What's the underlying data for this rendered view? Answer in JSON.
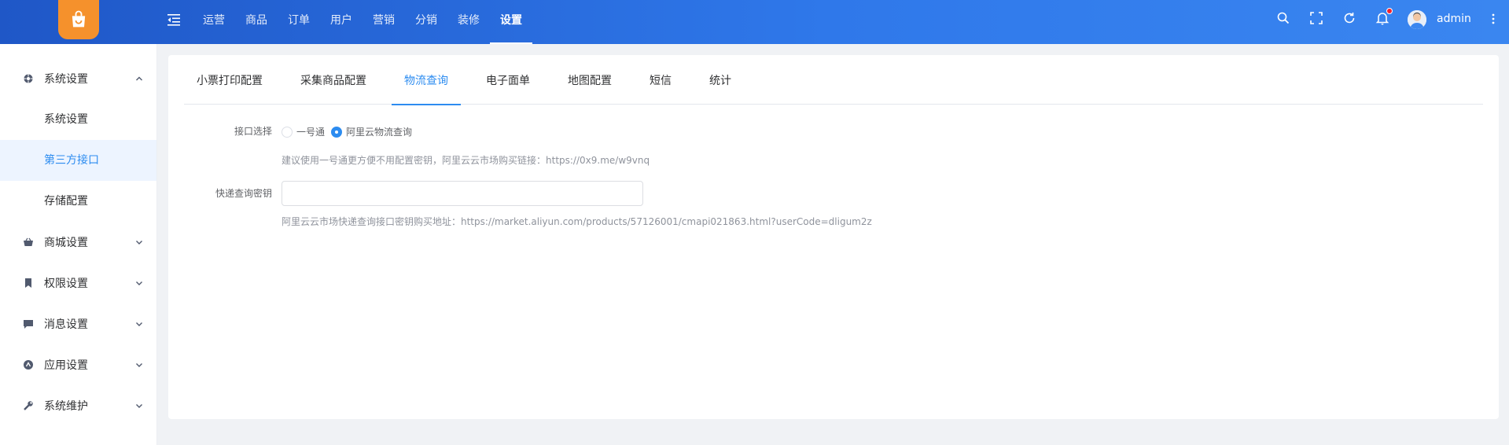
{
  "header": {
    "nav": [
      "运营",
      "商品",
      "订单",
      "用户",
      "营销",
      "分销",
      "装修",
      "设置"
    ],
    "active_nav": "设置",
    "icons": [
      "search-icon",
      "fullscreen-icon",
      "refresh-icon",
      "bell-icon",
      "more-icon"
    ],
    "username": "admin",
    "accent": "#2d8cf0"
  },
  "sidebar": {
    "groups": [
      {
        "label": "系统设置",
        "icon": "settings-icon",
        "expanded": true,
        "children": [
          "系统设置",
          "第三方接口",
          "存储配置"
        ],
        "active_child": "第三方接口"
      },
      {
        "label": "商城设置",
        "icon": "shop-icon",
        "expanded": false
      },
      {
        "label": "权限设置",
        "icon": "bookmark-icon",
        "expanded": false
      },
      {
        "label": "消息设置",
        "icon": "message-icon",
        "expanded": false
      },
      {
        "label": "应用设置",
        "icon": "app-icon",
        "expanded": false
      },
      {
        "label": "系统维护",
        "icon": "wrench-icon",
        "expanded": false
      }
    ]
  },
  "tabs": [
    "小票打印配置",
    "采集商品配置",
    "物流查询",
    "电子面单",
    "地图配置",
    "短信",
    "统计"
  ],
  "active_tab": "物流查询",
  "form": {
    "interface_label": "接口选择",
    "options": [
      "一号通",
      "阿里云物流查询"
    ],
    "selected_option": "阿里云物流查询",
    "interface_hint": "建议使用一号通更方便不用配置密钥，阿里云云市场购买链接：https://0x9.me/w9vnq",
    "key_label": "快递查询密钥",
    "key_value": "",
    "key_hint": "阿里云云市场快递查询接口密钥购买地址：https://market.aliyun.com/products/57126001/cmapi021863.html?userCode=dligum2z"
  }
}
